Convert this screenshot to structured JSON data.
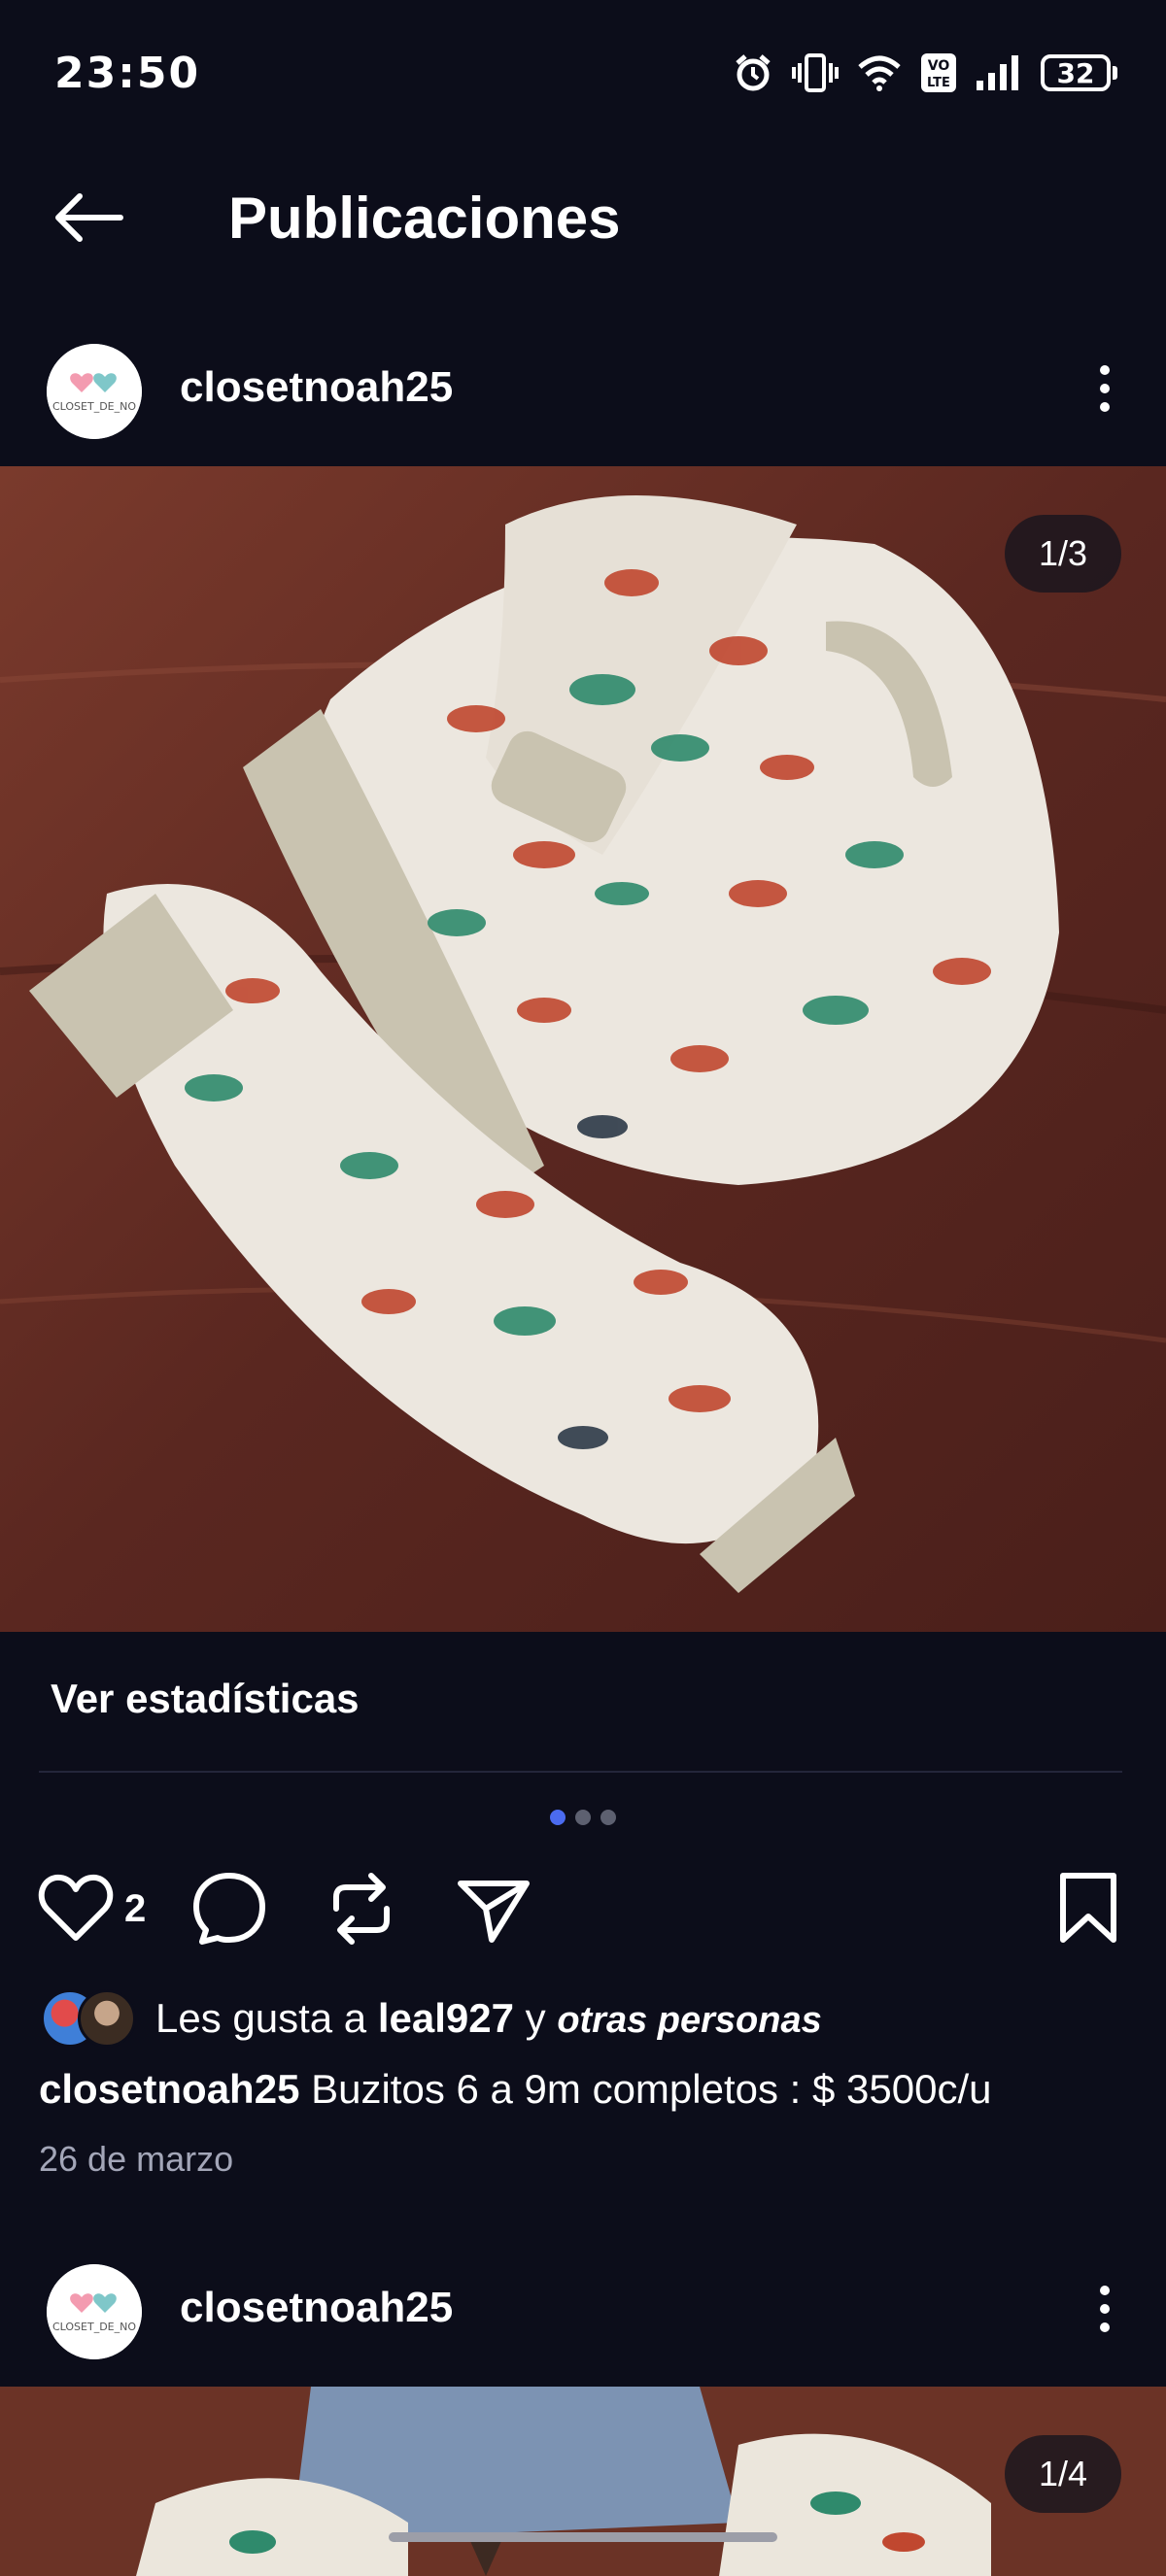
{
  "status_bar": {
    "time": "23:50",
    "icons": [
      "alarm-icon",
      "vibrate-icon",
      "wifi-icon",
      "volte-icon",
      "signal-icon"
    ],
    "volte_label": "VO\nLTE",
    "battery": "32"
  },
  "header": {
    "back_icon": "arrow-left-icon",
    "title": "Publicaciones"
  },
  "posts": [
    {
      "username": "closetnoah25",
      "avatar_text": "CLOSET_DE_NO",
      "image_counter": "1/3",
      "stats_label": "Ver estadísticas",
      "carousel_dots": 3,
      "carousel_active": 0,
      "like_count": "2",
      "likes_prefix": "Les gusta a ",
      "likes_user": "leal927",
      "likes_and": " y ",
      "likes_others": "otras personas",
      "caption_user": "closetnoah25",
      "caption_text": " Buzitos 6 a 9m completos : $ 3500c/u",
      "date": "26 de marzo"
    },
    {
      "username": "closetnoah25",
      "avatar_text": "CLOSET_DE_NO",
      "image_counter": "1/4"
    }
  ],
  "colors": {
    "background": "#0c0d1a",
    "accent_dot": "#4b6bf0",
    "muted_text": "#a3a6b8"
  }
}
